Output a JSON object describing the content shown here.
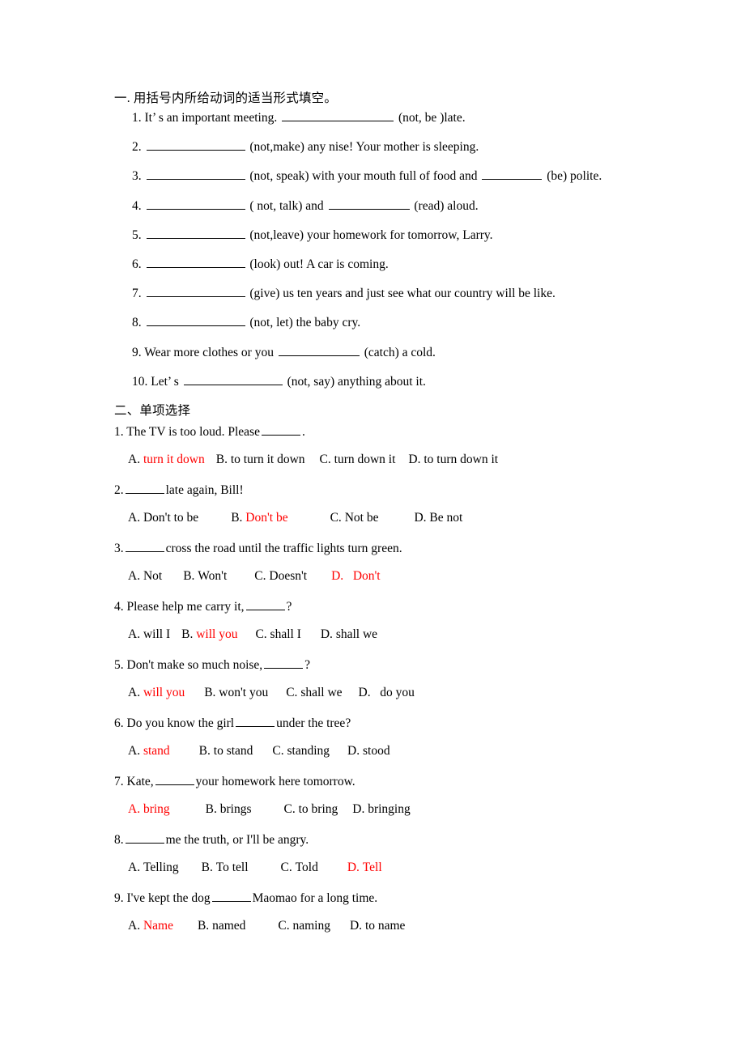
{
  "document": {
    "section_one": {
      "heading": "一. 用括号内所给动词的适当形式填空。",
      "items": [
        {
          "num": "1.",
          "pre": "It’ s an important meeting.",
          "post": "(not, be )late.",
          "blank": "b-xl"
        },
        {
          "num": "2.",
          "pre": "",
          "post": "(not,make) any nise! Your mother is sleeping.",
          "blank": "b-lg"
        },
        {
          "num": "3.",
          "pre": "",
          "mid": "(not, speak) with your mouth full of food and",
          "post": "(be) polite.",
          "blank": "b-lg",
          "blank2": "b-sm"
        },
        {
          "num": "4.",
          "pre": "",
          "mid": "( not, talk) and",
          "post": "(read) aloud.",
          "blank": "b-lg",
          "blank2": "b-md"
        },
        {
          "num": "5.",
          "pre": "",
          "post": "(not,leave) your homework for tomorrow, Larry.",
          "blank": "b-lg"
        },
        {
          "num": "6.",
          "pre": "",
          "post": "(look) out! A car is coming.",
          "blank": "b-lg"
        },
        {
          "num": "7.",
          "pre": "",
          "post": "(give) us ten years and just see what our country will be like.",
          "blank": "b-lg"
        },
        {
          "num": "8.",
          "pre": "",
          "post": "(not, let) the baby cry.",
          "blank": "b-lg"
        },
        {
          "num": "9.",
          "pre": "Wear more clothes or you",
          "post": "(catch) a cold.",
          "blank": "b-md"
        },
        {
          "num": "10.",
          "pre": "Let’ s",
          "post": "(not, say) anything about it.",
          "blank": "b-lg"
        }
      ]
    },
    "section_two": {
      "heading": "二、单项选择",
      "questions": [
        {
          "stem_pre": "1. The TV is too loud. Please",
          "stem_post": ".",
          "blank": "b-xxs",
          "options": [
            {
              "label": "A.",
              "text": "turn it down",
              "answer": true
            },
            {
              "label": "B.",
              "text": "to turn it down",
              "answer": false
            },
            {
              "label": "C.",
              "text": "turn down it",
              "answer": false
            },
            {
              "label": "D.",
              "text": "to turn down it",
              "answer": false
            }
          ]
        },
        {
          "stem_pre": "2.",
          "stem_post": "late again, Bill!",
          "blank": "b-xxs",
          "options": [
            {
              "label": "A.",
              "text": "Don't to be",
              "answer": false
            },
            {
              "label": "B.",
              "text": "Don't be",
              "answer": true
            },
            {
              "label": "C.",
              "text": "Not be",
              "answer": false
            },
            {
              "label": "D.",
              "text": "Be not",
              "answer": false
            }
          ]
        },
        {
          "stem_pre": "3.",
          "stem_post": "cross the road until the traffic lights turn green.",
          "blank": "b-xxs",
          "options": [
            {
              "label": "A.",
              "text": "Not",
              "answer": false
            },
            {
              "label": "B.",
              "text": "Won't",
              "answer": false
            },
            {
              "label": "C.",
              "text": "Doesn't",
              "answer": false
            },
            {
              "label": "D.",
              "text": "Don't",
              "answer": true,
              "label_red": true,
              "spaced": true
            }
          ]
        },
        {
          "stem_pre": "4. Please help me carry it,",
          "stem_post": "?",
          "blank": "b-xxs",
          "options": [
            {
              "label": "A.",
              "text": "will I",
              "answer": false
            },
            {
              "label": "B.",
              "text": "will you",
              "answer": true
            },
            {
              "label": "C.",
              "text": "shall I",
              "answer": false
            },
            {
              "label": "D.",
              "text": "shall we",
              "answer": false
            }
          ]
        },
        {
          "stem_pre": "5. Don't make so much noise,",
          "stem_post": "?",
          "blank": "b-xxs",
          "options": [
            {
              "label": "A.",
              "text": "will you",
              "answer": true
            },
            {
              "label": "B.",
              "text": "won't you",
              "answer": false
            },
            {
              "label": "C.",
              "text": "shall we",
              "answer": false
            },
            {
              "label": "D.",
              "text": "do you",
              "answer": false,
              "spaced": true
            }
          ]
        },
        {
          "stem_pre": "6. Do you know the girl",
          "stem_post": "under the tree?",
          "blank": "b-xxs",
          "options": [
            {
              "label": "A.",
              "text": "stand",
              "answer": true
            },
            {
              "label": "B.",
              "text": "to stand",
              "answer": false
            },
            {
              "label": "C.",
              "text": "standing",
              "answer": false
            },
            {
              "label": "D.",
              "text": "stood",
              "answer": false
            }
          ]
        },
        {
          "stem_pre": "7. Kate,",
          "stem_post": "your homework here tomorrow.",
          "blank": "b-xxs",
          "options": [
            {
              "label": "A.",
              "text": "bring",
              "answer": true,
              "label_red": true
            },
            {
              "label": "B.",
              "text": "brings",
              "answer": false
            },
            {
              "label": "C.",
              "text": "to bring",
              "answer": false
            },
            {
              "label": "D.",
              "text": "bringing",
              "answer": false
            }
          ]
        },
        {
          "stem_pre": "8.",
          "stem_post": "me the truth, or I'll be angry.",
          "blank": "b-xxs",
          "options": [
            {
              "label": "A.",
              "text": "Telling",
              "answer": false
            },
            {
              "label": "B.",
              "text": "To tell",
              "answer": false
            },
            {
              "label": "C.",
              "text": "Told",
              "answer": false
            },
            {
              "label": "D.",
              "text": "Tell",
              "answer": true,
              "label_red": true
            }
          ]
        },
        {
          "stem_pre": "9. I've kept the dog",
          "stem_post": "Maomao for a long time.",
          "blank": "b-xxs",
          "options": [
            {
              "label": "A.",
              "text": "Name",
              "answer": true
            },
            {
              "label": "B.",
              "text": "named",
              "answer": false
            },
            {
              "label": "C.",
              "text": "naming",
              "answer": false
            },
            {
              "label": "D.",
              "text": "to name",
              "answer": false
            }
          ]
        }
      ]
    }
  },
  "colors": {
    "answer_red": "#ff0000",
    "text_black": "#000000",
    "page_background": "#ffffff"
  }
}
